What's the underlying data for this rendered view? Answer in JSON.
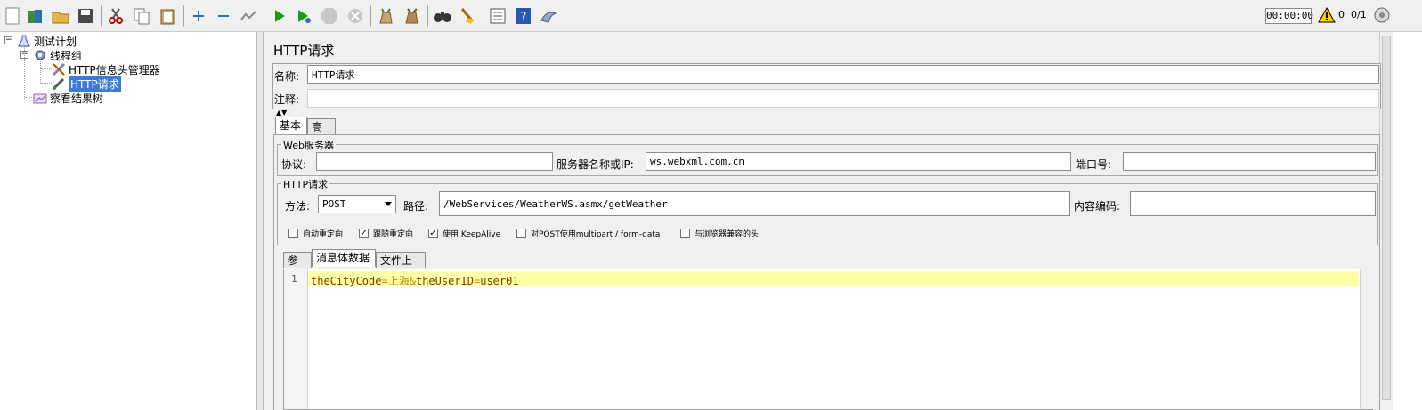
{
  "toolbar": {
    "timer": "00:00:00",
    "warning_count": "0",
    "threads": "0/1"
  },
  "tree": {
    "test_plan": "测试计划",
    "thread_group": "线程组",
    "header_manager": "HTTP信息头管理器",
    "http_request": "HTTP请求",
    "result_tree": "察看结果树"
  },
  "panel": {
    "title": "HTTP请求",
    "name_label": "名称:",
    "name_value": "HTTP请求",
    "comment_label": "注释:"
  },
  "tabs": {
    "basic": "基本",
    "advanced": "高级"
  },
  "web_server": {
    "legend": "Web服务器",
    "protocol_label": "协议:",
    "protocol_value": "",
    "server_label": "服务器名称或IP:",
    "server_value": "ws.webxml.com.cn",
    "port_label": "端口号:",
    "port_value": ""
  },
  "http_section": {
    "legend": "HTTP请求",
    "method_label": "方法:",
    "method_value": "POST",
    "path_label": "路径:",
    "path_value": "/WebServices/WeatherWS.asmx/getWeather",
    "encoding_label": "内容编码:",
    "encoding_value": ""
  },
  "checkboxes": [
    {
      "label": "自动重定向",
      "checked": false
    },
    {
      "label": "跟随重定向",
      "checked": true
    },
    {
      "label": "使用 KeepAlive",
      "checked": true
    },
    {
      "label": "对POST使用multipart / form-data",
      "checked": false
    },
    {
      "label": "与浏览器兼容的头",
      "checked": false
    }
  ],
  "subtabs": {
    "params": "参数",
    "body": "消息体数据",
    "files": "文件上传"
  },
  "editor": {
    "line_number": "1",
    "key1": "theCityCode",
    "eq1": "=",
    "val1": "上海",
    "amp": "&",
    "key2": "theUserID",
    "eq2": "=",
    "val2": "user01"
  },
  "colors": {
    "selection": "#3d7bd9",
    "current_line": "#ffffa8",
    "run_green": "#1a9a1a"
  }
}
